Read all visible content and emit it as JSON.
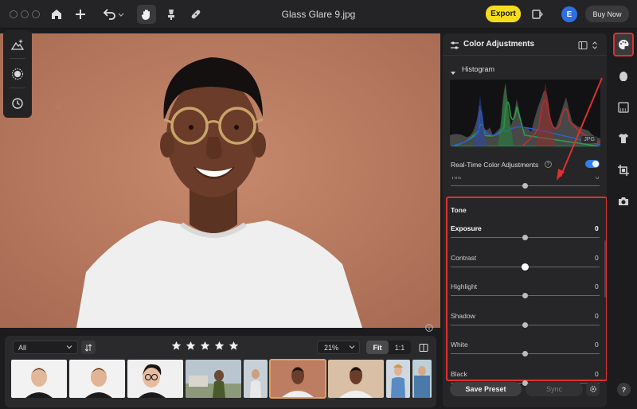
{
  "window": {
    "title": "Glass Glare 9.jpg"
  },
  "toolbar": {
    "export_label": "Export",
    "user_initial": "E",
    "buy_label": "Buy Now"
  },
  "filmstrip": {
    "filter_value": "All",
    "zoom_value": "21%",
    "fit_label": "Fit",
    "one_to_one_label": "1:1",
    "stack_count": "7",
    "star_count": 5
  },
  "panel": {
    "title": "Color Adjustments",
    "histogram_label": "Histogram",
    "histogram_badge": "JPG",
    "realtime_label": "Real-Time Color Adjustments",
    "realtime_enabled": true,
    "tint_label": "Tint",
    "tint_value": "0",
    "tone_title": "Tone",
    "sliders": [
      {
        "label": "Exposure",
        "value": "0"
      },
      {
        "label": "Contrast",
        "value": "0"
      },
      {
        "label": "Highlight",
        "value": "0"
      },
      {
        "label": "Shadow",
        "value": "0"
      },
      {
        "label": "White",
        "value": "0"
      },
      {
        "label": "Black",
        "value": "0"
      }
    ],
    "save_preset_label": "Save Preset",
    "sync_label": "Sync"
  },
  "rail": {
    "help_label": "?"
  },
  "colors": {
    "accent_export": "#f5dd1e",
    "highlight_border": "#e03030",
    "toggle_on": "#2f7ff0",
    "photo_background": "#bd7d62"
  },
  "icons": [
    "home-icon",
    "plus-icon",
    "undo-icon",
    "hand-icon",
    "stamp-icon",
    "bandage-icon",
    "panel-toggle-icon",
    "mountain-sparkle-icon",
    "sun-icon",
    "history-icon",
    "sort-icon",
    "star-icon",
    "compare-icon",
    "palette-icon",
    "face-icon",
    "gradient-icon",
    "shirt-icon",
    "crop-icon",
    "camera-icon",
    "info-icon",
    "gear-icon",
    "sliders-icon",
    "layout-icon"
  ]
}
